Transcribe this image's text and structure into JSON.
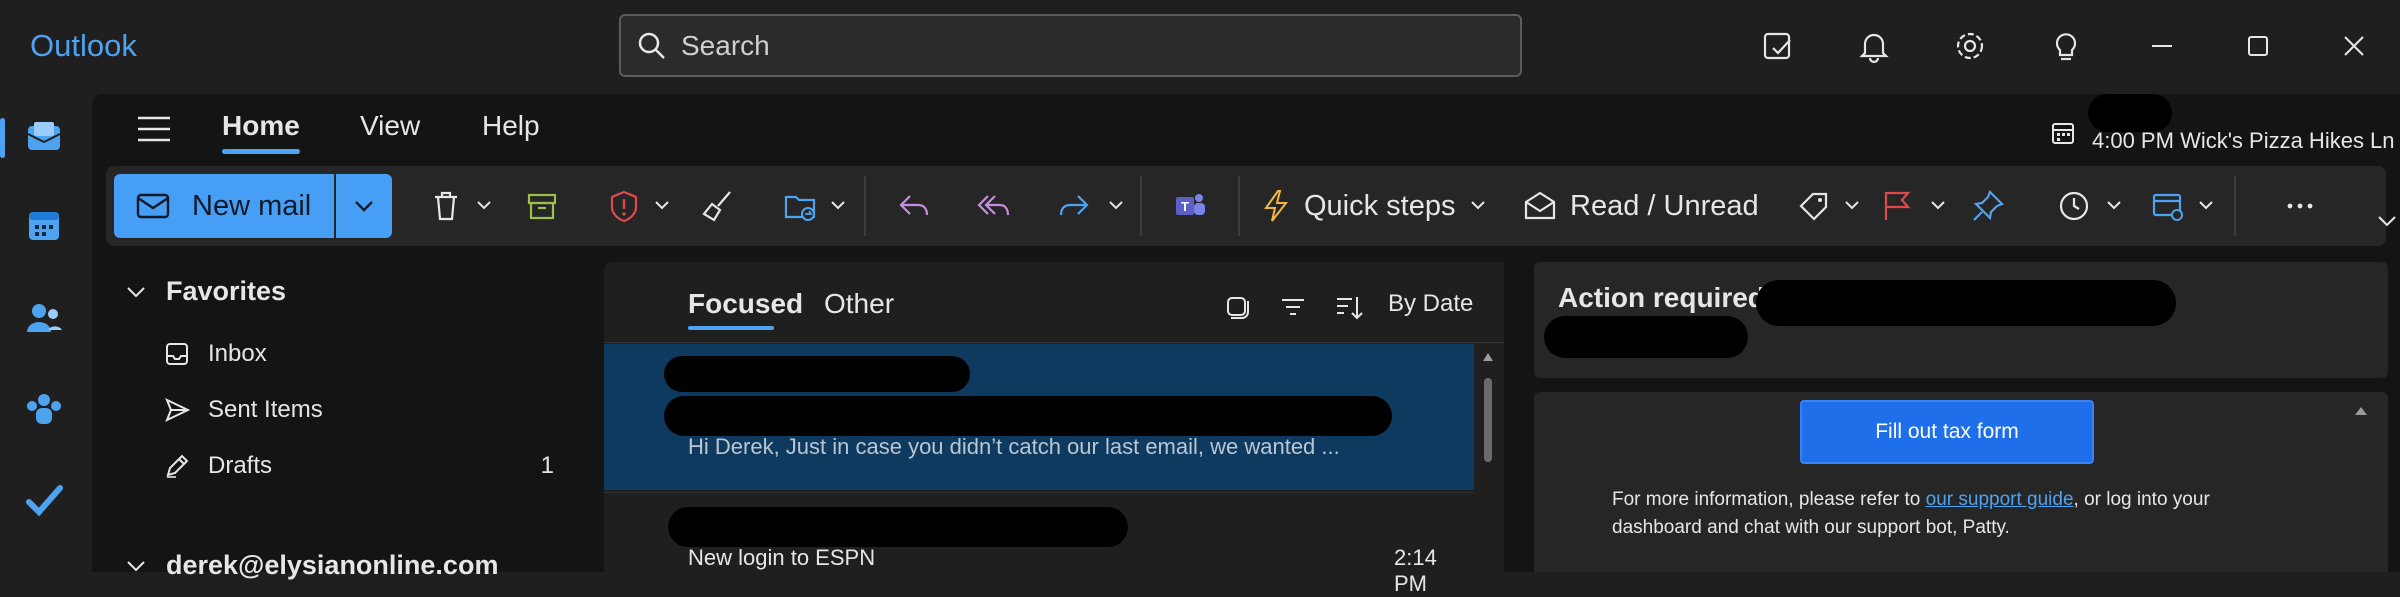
{
  "app": {
    "name": "Outlook"
  },
  "search": {
    "placeholder": "Search"
  },
  "titlebar_icons": [
    "todo-icon",
    "bell-icon",
    "gear-icon",
    "lightbulb-icon"
  ],
  "window_controls": [
    "minimize-icon",
    "maximize-icon",
    "close-icon"
  ],
  "navrail": [
    "mail-icon",
    "calendar-icon",
    "people-icon",
    "groups-icon",
    "todo-check-icon"
  ],
  "tabs": {
    "home": "Home",
    "view": "View",
    "help": "Help"
  },
  "calendar_event": {
    "time": "4:00 PM",
    "title": "Wick's Pizza Hikes Ln"
  },
  "ribbon": {
    "new_mail": "New mail",
    "quick_steps": "Quick steps",
    "read_unread": "Read / Unread"
  },
  "folders": {
    "favorites": "Favorites",
    "items": [
      {
        "label": "Inbox",
        "count": ""
      },
      {
        "label": "Sent Items",
        "count": ""
      },
      {
        "label": "Drafts",
        "count": "1"
      }
    ],
    "account": "derek@elysianonline.com"
  },
  "mail_list": {
    "tab_focused": "Focused",
    "tab_other": "Other",
    "sort_label": "By Date",
    "items": [
      {
        "preview": "Hi Derek, Just in case you didn’t catch our last email, we wanted ..."
      },
      {
        "subject": "New login to ESPN",
        "time": "2:14 PM"
      }
    ]
  },
  "reading": {
    "title": "Action required.",
    "button": "Fill out tax form",
    "body_prefix": "For more information, please refer to ",
    "link": "our support guide",
    "body_suffix": ", or log into your dashboard and chat with our support bot, Patty."
  },
  "colors": {
    "accent": "#4ea3f1",
    "new_mail_bg": "#479ef5",
    "selected_row": "#0f3a5f",
    "cta": "#1f6feb"
  }
}
